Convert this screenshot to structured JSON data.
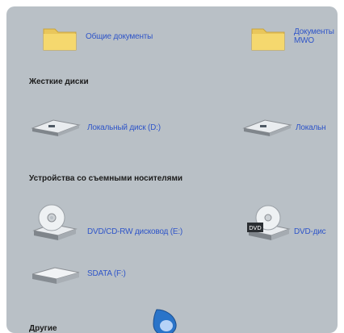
{
  "items_top": [
    {
      "label": "Общие документы",
      "icon": "folder-icon"
    },
    {
      "label": "Документы\nMWO",
      "icon": "folder-icon"
    }
  ],
  "sections": {
    "hard_drives": "Жесткие диски",
    "removable": "Устройства со съемными носителями",
    "other": "Другие"
  },
  "hard_drives": [
    {
      "label": "Локальный диск (D:)",
      "icon": "hard-drive-icon"
    },
    {
      "label": "Локальн",
      "icon": "hard-drive-icon"
    }
  ],
  "removable": [
    {
      "label": "DVD/CD-RW дисковод (E:)",
      "icon": "cd-drive-icon"
    },
    {
      "label": "DVD-дис",
      "icon": "dvd-drive-icon"
    },
    {
      "label": "SDATA (F:)",
      "icon": "removable-drive-icon"
    }
  ],
  "colors": {
    "panel": "#b9c0c6",
    "link": "#2f55c8",
    "folder": "#f3d46a"
  }
}
